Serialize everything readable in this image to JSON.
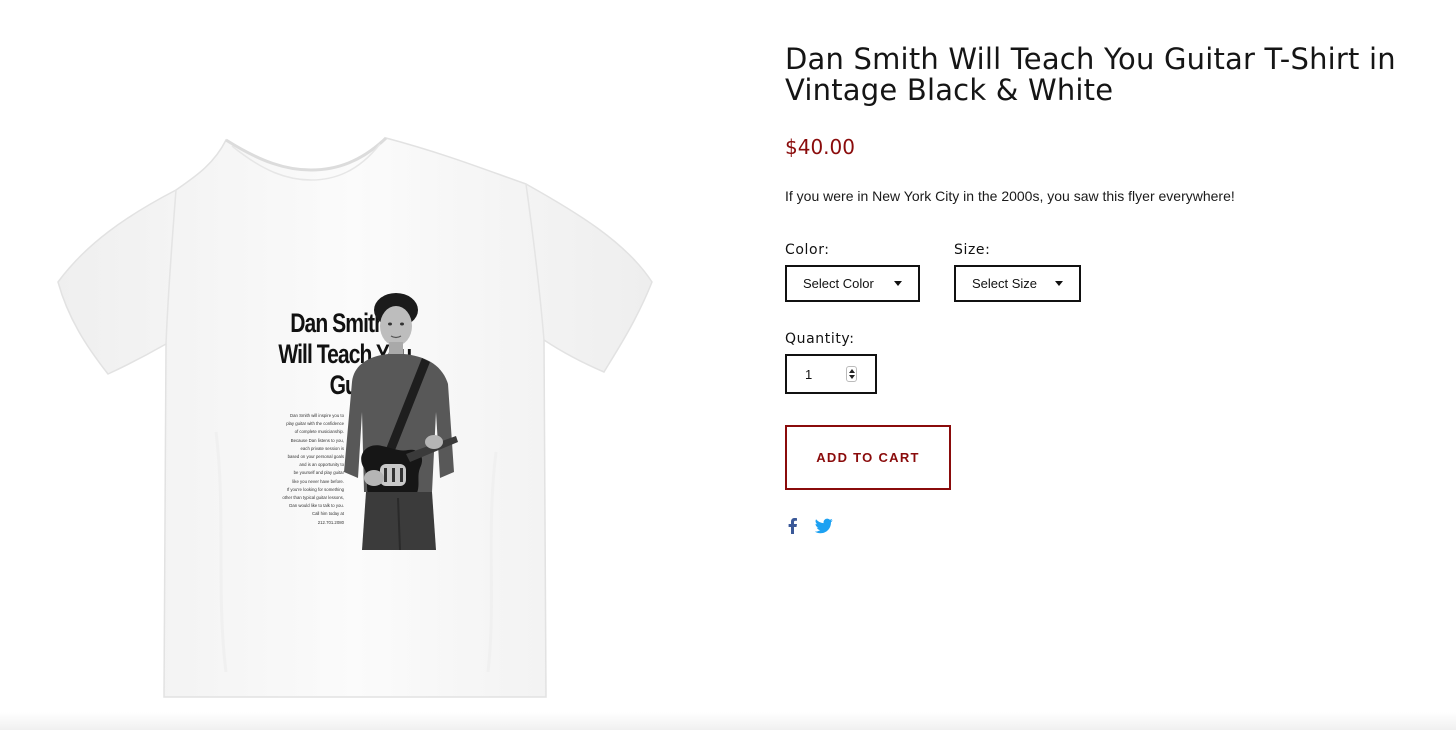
{
  "product": {
    "title": "Dan Smith Will Teach You Guitar T-Shirt in Vintage Black & White",
    "price": "$40.00",
    "description": "If you were in New York City in the 2000s, you saw this flyer everywhere!"
  },
  "image": {
    "alt": "White t-shirt with Dan Smith guitar flyer print",
    "print": {
      "headline": [
        "Dan Smith",
        "Will Teach You",
        "Guitar"
      ],
      "body_lines": [
        "Dan Smith will inspire you to",
        "play guitar with the confidence",
        "of complete musicianship.",
        "Because Dan listens to you,",
        "each private session is",
        "based on your personal goals",
        "and is an opportunity to",
        "be yourself and play guitar",
        "like you never have before.",
        "If you're looking for something",
        "other than typical guitar lessons,",
        "Dan would like to talk to you.",
        "Call him today at",
        "212.701.2080"
      ]
    }
  },
  "options": {
    "color": {
      "label": "Color:",
      "selected": "Select Color"
    },
    "size": {
      "label": "Size:",
      "selected": "Select Size"
    },
    "quantity": {
      "label": "Quantity:",
      "value": "1"
    }
  },
  "actions": {
    "add_to_cart": "ADD TO CART"
  },
  "share": {
    "facebook_icon": "facebook-icon",
    "twitter_icon": "twitter-icon"
  },
  "colors": {
    "accent": "#8a0b0b",
    "facebook": "#3b5998",
    "twitter": "#1da1f2",
    "text": "#111111"
  }
}
